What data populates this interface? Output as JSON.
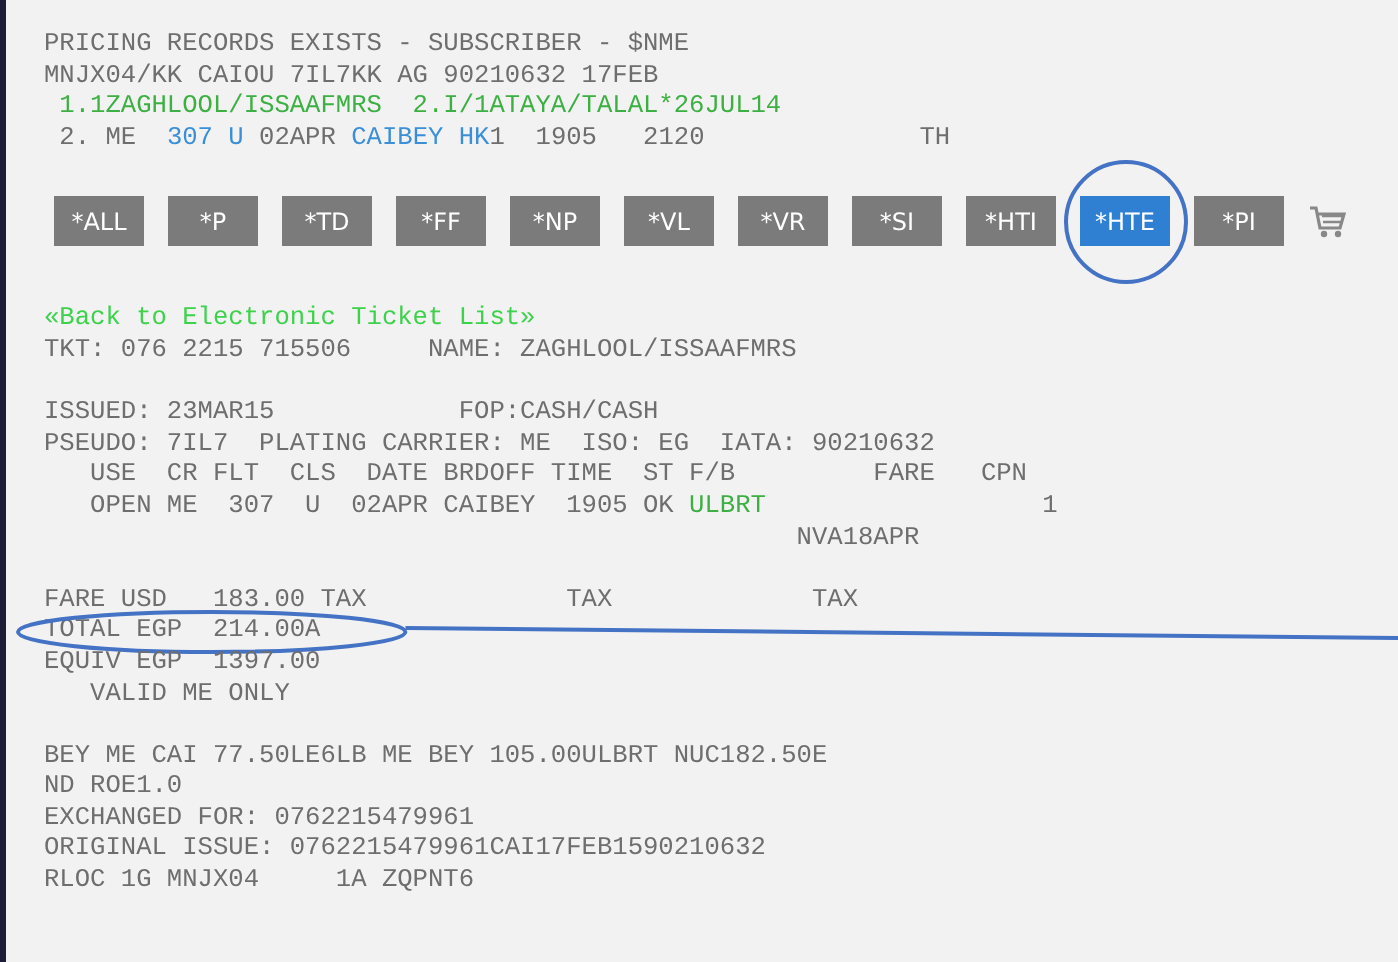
{
  "header_lines": [
    [
      {
        "text": "PRICING RECORDS EXISTS - SUBSCRIBER - $NME",
        "kind": "plain"
      }
    ],
    [
      {
        "text": "MNJX04/KK CAIOU 7IL7KK AG 90210632 17FEB",
        "kind": "plain"
      }
    ],
    [
      {
        "text": " 1.1ZAGHLOOL/ISSAAFMRS  2.I/1ATAYA/TALAL*26JUL14",
        "kind": "name"
      }
    ],
    [
      {
        "text": " 2. ME  ",
        "kind": "plain"
      },
      {
        "text": "307 U",
        "kind": "flight"
      },
      {
        "text": " 02APR ",
        "kind": "plain"
      },
      {
        "text": "CAIBEY HK",
        "kind": "flight"
      },
      {
        "text": "1  1905   2120              TH",
        "kind": "plain"
      }
    ]
  ],
  "buttons": [
    {
      "label": "*ALL",
      "selected": false,
      "circled": false
    },
    {
      "label": "*P",
      "selected": false,
      "circled": false
    },
    {
      "label": "*TD",
      "selected": false,
      "circled": false
    },
    {
      "label": "*FF",
      "selected": false,
      "circled": false
    },
    {
      "label": "*NP",
      "selected": false,
      "circled": false
    },
    {
      "label": "*VL",
      "selected": false,
      "circled": false
    },
    {
      "label": "*VR",
      "selected": false,
      "circled": false
    },
    {
      "label": "*SI",
      "selected": false,
      "circled": false
    },
    {
      "label": "*HTI",
      "selected": false,
      "circled": false
    },
    {
      "label": "*HTE",
      "selected": true,
      "circled": true
    },
    {
      "label": "*PI",
      "selected": false,
      "circled": false
    }
  ],
  "back_link": "«Back to Electronic Ticket List»",
  "ticket_blocks": [
    [
      {
        "segments": [
          {
            "text": "TKT: 076 2215 715506     NAME: ZAGHLOOL/ISSAAFMRS",
            "kind": "plain"
          }
        ],
        "circled": false
      }
    ],
    [
      {
        "segments": [
          {
            "text": "ISSUED: 23MAR15            FOP:CASH/CASH",
            "kind": "plain"
          }
        ],
        "circled": false
      },
      {
        "segments": [
          {
            "text": "PSEUDO: 7IL7  PLATING CARRIER: ME  ISO: EG  IATA: 90210632",
            "kind": "plain"
          }
        ],
        "circled": false
      },
      {
        "segments": [
          {
            "text": "   USE  CR FLT  CLS  DATE BRDOFF TIME  ST F/B         FARE   CPN",
            "kind": "plain"
          }
        ],
        "circled": false
      },
      {
        "segments": [
          {
            "text": "   OPEN ME  307  U  02APR CAIBEY  1905 OK ",
            "kind": "plain"
          },
          {
            "text": "ULBRT",
            "kind": "name"
          },
          {
            "text": "                  1",
            "kind": "plain"
          }
        ],
        "circled": false
      },
      {
        "segments": [
          {
            "text": "                                                 NVA18APR",
            "kind": "plain"
          }
        ],
        "circled": false
      }
    ],
    [
      {
        "segments": [
          {
            "text": "FARE USD   183.00 TAX             TAX             TAX",
            "kind": "plain"
          }
        ],
        "circled": false
      },
      {
        "segments": [
          {
            "text": "TOTAL EGP  214.00A",
            "kind": "plain"
          }
        ],
        "circled": true
      },
      {
        "segments": [
          {
            "text": "EQUIV EGP  1397.00",
            "kind": "plain"
          }
        ],
        "circled": false
      },
      {
        "segments": [
          {
            "text": "   VALID ME ONLY",
            "kind": "plain"
          }
        ],
        "circled": false
      }
    ],
    [
      {
        "segments": [
          {
            "text": "BEY ME CAI 77.50LE6LB ME BEY 105.00ULBRT NUC182.50E",
            "kind": "plain"
          }
        ],
        "circled": false
      },
      {
        "segments": [
          {
            "text": "ND ROE1.0",
            "kind": "plain"
          }
        ],
        "circled": false
      },
      {
        "segments": [
          {
            "text": "EXCHANGED FOR: 0762215479961",
            "kind": "plain"
          }
        ],
        "circled": false
      },
      {
        "segments": [
          {
            "text": "ORIGINAL ISSUE: 0762215479961CAI17FEB1590210632",
            "kind": "plain"
          }
        ],
        "circled": false
      },
      {
        "segments": [
          {
            "text": "RLOC 1G MNJX04     1A ZQPNT6",
            "kind": "plain"
          }
        ],
        "circled": false
      }
    ]
  ]
}
